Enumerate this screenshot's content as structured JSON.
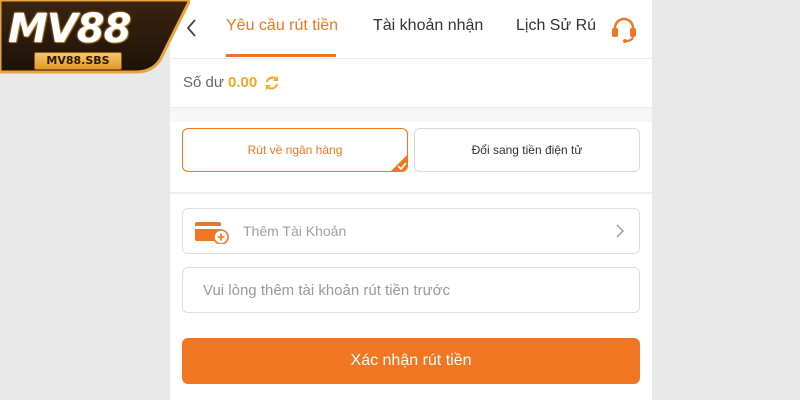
{
  "logo": {
    "brand": "MV88",
    "domain": "MV88.SBS"
  },
  "header": {
    "tabs": [
      {
        "label": "Yêu cầu rút tiền",
        "active": true
      },
      {
        "label": "Tài khoản nhận",
        "active": false
      },
      {
        "label": "Lịch Sử Rú",
        "active": false
      }
    ],
    "icons": {
      "back": "chevron-left-icon",
      "support": "headset-icon"
    }
  },
  "balance": {
    "label": "Số dư",
    "value": "0.00",
    "icon": "refresh-icon"
  },
  "methods": [
    {
      "label": "Rút về ngân hàng",
      "selected": true
    },
    {
      "label": "Đổi sang tiền điện tử",
      "selected": false
    }
  ],
  "account": {
    "add_label": "Thêm Tài Khoản",
    "icon": "card-add-icon"
  },
  "input": {
    "placeholder": "Vui lòng thêm tài khoản rút tiền trước",
    "value": ""
  },
  "submit": {
    "label": "Xác nhận rút tiền"
  },
  "colors": {
    "accent": "#f07621",
    "balance": "#f5a623",
    "background": "#e9e9e9"
  }
}
